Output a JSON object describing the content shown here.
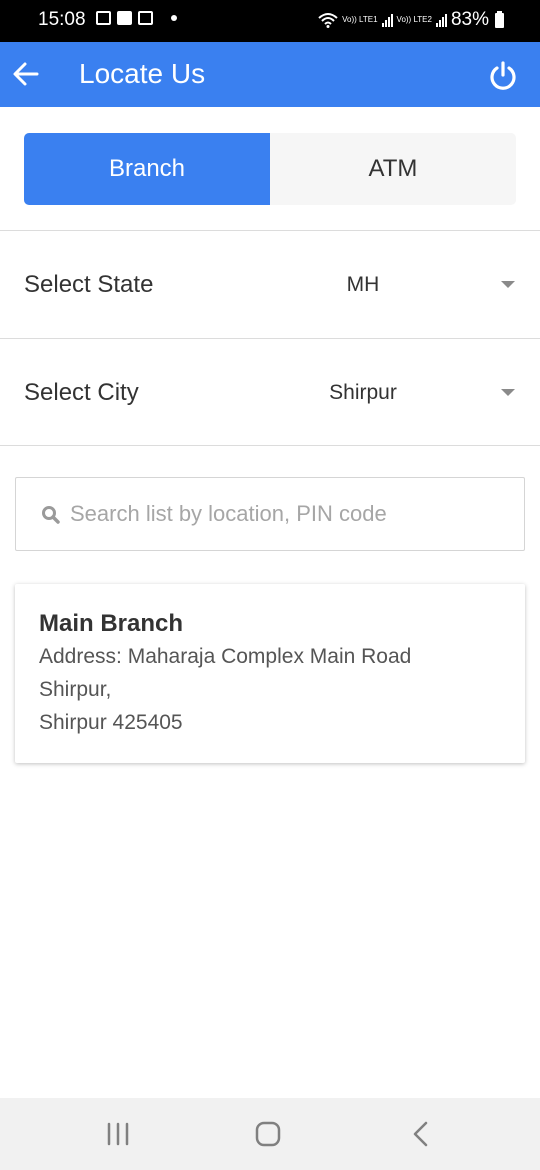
{
  "status_bar": {
    "time": "15:08",
    "notification_icons": [
      "image-icon",
      "facebook-icon",
      "message-icon",
      "dot-icon"
    ],
    "network": [
      "Vo)) LTE1",
      "Vo)) LTE2"
    ],
    "battery": "83%"
  },
  "app_bar": {
    "title": "Locate Us",
    "back_icon": "arrow-left-icon",
    "power_icon": "power-icon",
    "color": "#3a80f0"
  },
  "tabs": [
    {
      "label": "Branch",
      "active": true
    },
    {
      "label": "ATM",
      "active": false
    }
  ],
  "filters": {
    "state": {
      "label": "Select State",
      "value": "MH"
    },
    "city": {
      "label": "Select City",
      "value": "Shirpur"
    }
  },
  "search": {
    "placeholder": "Search list by location, PIN code",
    "value": ""
  },
  "results": [
    {
      "name": "Main Branch",
      "address_lines": [
        "Address: Maharaja Complex Main Road",
        "Shirpur,",
        "Shirpur 425405"
      ]
    }
  ],
  "nav_bar": {
    "buttons": [
      "recent-apps",
      "home",
      "back"
    ]
  }
}
